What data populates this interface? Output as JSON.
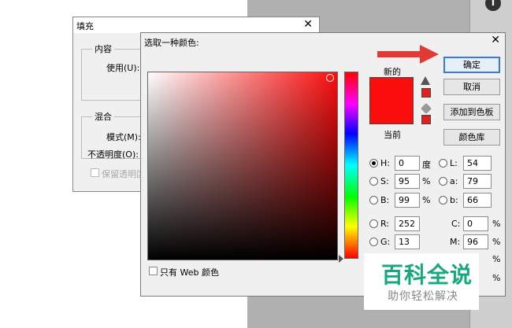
{
  "fill_dialog": {
    "title": "填充",
    "close": "✕",
    "content_group": "内容",
    "use_label": "使用(U):",
    "blend_group": "混合",
    "mode_label": "模式(M):",
    "opacity_label": "不透明度(O):",
    "preserve_label": "保留透明区"
  },
  "picker": {
    "title": "选取一种颜色:",
    "close": "✕",
    "new_label": "新的",
    "current_label": "当前",
    "new_color": "#fc0d0d",
    "current_color": "#fc0d0d",
    "gamut_color": "#e02020",
    "ok": "确定",
    "cancel": "取消",
    "add_swatch": "添加到色板",
    "libraries": "颜色库",
    "web_only": "只有 Web 颜色",
    "fields": {
      "H": {
        "label": "H:",
        "value": "0",
        "unit": "度"
      },
      "S": {
        "label": "S:",
        "value": "95",
        "unit": "%"
      },
      "B": {
        "label": "B:",
        "value": "99",
        "unit": "%"
      },
      "R": {
        "label": "R:",
        "value": "252"
      },
      "G": {
        "label": "G:",
        "value": "13"
      },
      "L": {
        "label": "L:",
        "value": "54"
      },
      "a": {
        "label": "a:",
        "value": "79"
      },
      "b": {
        "label": "b:",
        "value": "66"
      },
      "C": {
        "label": "C:",
        "value": "0",
        "unit": "%"
      },
      "M": {
        "label": "M:",
        "value": "96",
        "unit": "%"
      },
      "Y_unit": "%",
      "K_unit": "%"
    }
  },
  "watermark": {
    "big": "百科全说",
    "small": "助你轻松解决"
  },
  "colors": {
    "accent": "#3c78d8",
    "arrow": "#e53935",
    "watermark": "#19a77f"
  },
  "icons": {
    "info": "info-icon",
    "gamut": "warning-icon",
    "websafe": "cube-icon"
  }
}
